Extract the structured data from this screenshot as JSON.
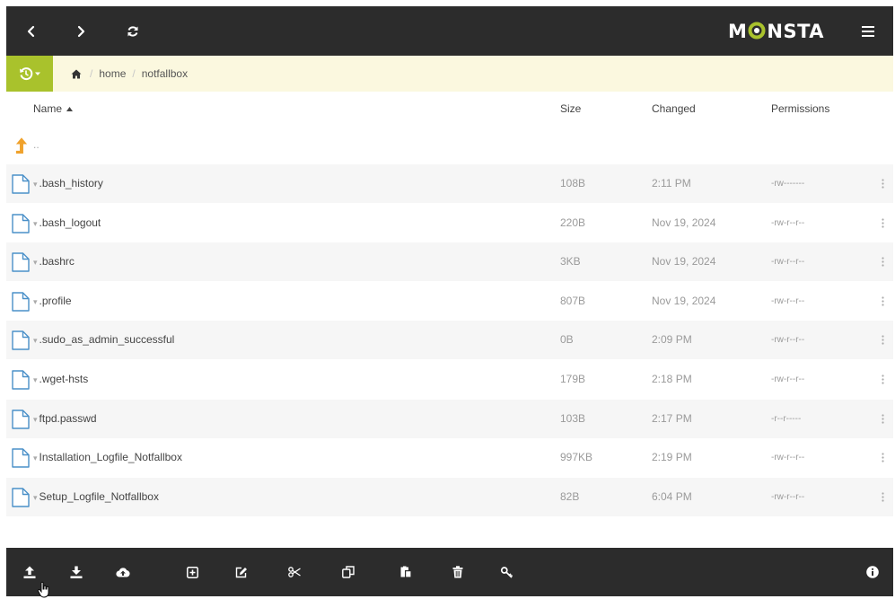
{
  "header": {
    "logo_left": "M",
    "logo_right": "NSTA",
    "colors": {
      "bg": "#2c2c2c",
      "accent": "#a9c22c"
    }
  },
  "breadcrumb": {
    "items": [
      "home",
      "notfallbox"
    ],
    "separator": "/"
  },
  "table": {
    "columns": {
      "name": "Name",
      "size": "Size",
      "changed": "Changed",
      "permissions": "Permissions"
    },
    "parent_label": "..",
    "rows": [
      {
        "name": ".bash_history",
        "size": "108B",
        "changed": "2:11 PM",
        "permissions": "-rw-------"
      },
      {
        "name": ".bash_logout",
        "size": "220B",
        "changed": "Nov 19, 2024",
        "permissions": "-rw-r--r--"
      },
      {
        "name": ".bashrc",
        "size": "3KB",
        "changed": "Nov 19, 2024",
        "permissions": "-rw-r--r--"
      },
      {
        "name": ".profile",
        "size": "807B",
        "changed": "Nov 19, 2024",
        "permissions": "-rw-r--r--"
      },
      {
        "name": ".sudo_as_admin_successful",
        "size": "0B",
        "changed": "2:09 PM",
        "permissions": "-rw-r--r--"
      },
      {
        "name": ".wget-hsts",
        "size": "179B",
        "changed": "2:18 PM",
        "permissions": "-rw-r--r--"
      },
      {
        "name": "ftpd.passwd",
        "size": "103B",
        "changed": "2:17 PM",
        "permissions": "-r--r-----"
      },
      {
        "name": "Installation_Logfile_Notfallbox",
        "size": "997KB",
        "changed": "2:19 PM",
        "permissions": "-rw-r--r--"
      },
      {
        "name": "Setup_Logfile_Notfallbox",
        "size": "82B",
        "changed": "6:04 PM",
        "permissions": "-rw-r--r--"
      }
    ]
  },
  "toolbar": {
    "icons": [
      "upload-icon",
      "download-icon",
      "fetch-from-url-icon",
      "new-item-icon",
      "rename-icon",
      "cut-icon",
      "copy-icon",
      "paste-icon",
      "delete-icon",
      "change-permissions-icon",
      "info-icon"
    ]
  }
}
